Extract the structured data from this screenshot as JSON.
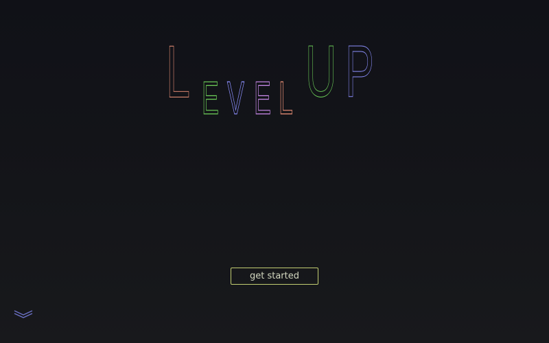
{
  "logo": {
    "letters": [
      {
        "char": "L",
        "color": "#f2957a"
      },
      {
        "char": "E",
        "color": "#6fd35a"
      },
      {
        "char": "V",
        "color": "#8d90ff"
      },
      {
        "char": "E",
        "color": "#cf8ef0"
      },
      {
        "char": "L",
        "color": "#f2957a"
      },
      {
        "char": "U",
        "color": "#6fd35a"
      },
      {
        "char": "P",
        "color": "#8d90ff"
      }
    ]
  },
  "cta": {
    "label": "get started",
    "border_color": "#c4cf73"
  },
  "scroll_hint": {
    "icon": "chevron-down-icon",
    "color": "#6d72c9"
  }
}
